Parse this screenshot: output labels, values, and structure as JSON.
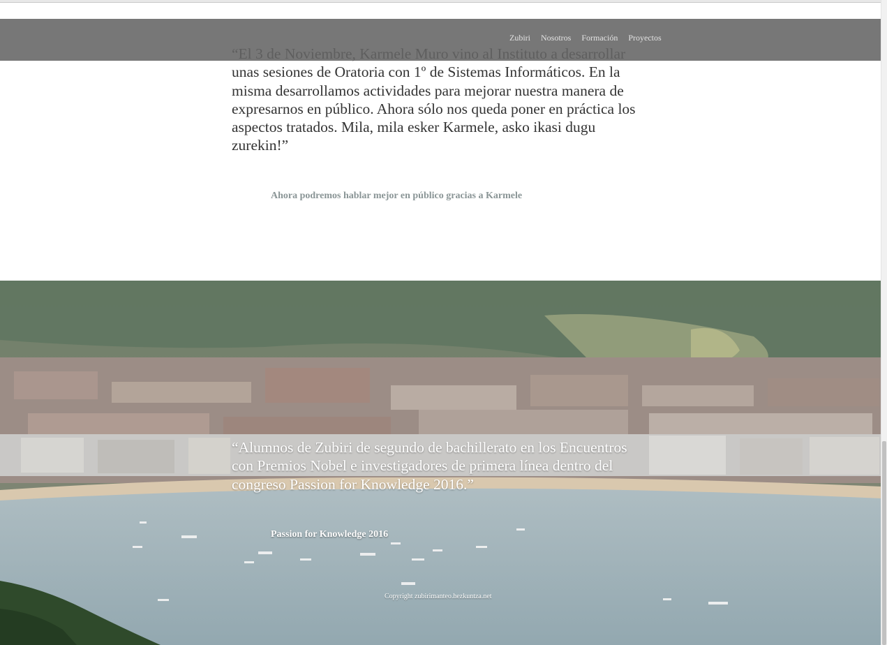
{
  "nav": {
    "items": [
      {
        "label": "Zubiri"
      },
      {
        "label": "Nosotros"
      },
      {
        "label": "Formación"
      },
      {
        "label": "Proyectos"
      }
    ]
  },
  "articles": [
    {
      "quote": "“El 3 de Noviembre, Karmele Muro vino al Instituto a desarrollar unas sesiones de Oratoria con 1º de Sistemas Informáticos. En la misma desarrollamos actividades para mejorar nuestra manera de expresarnos en público. Ahora sólo nos queda poner en práctica los aspectos tratados. Mila, mila esker Karmele, asko ikasi dugu zurekin!”",
      "caption": "Ahora podremos hablar mejor en público gracias a Karmele"
    },
    {
      "quote": "“Alumnos de Zubiri de segundo de bachillerato en los Encuentros con Premios Nobel e investigadores de primera línea dentro del congreso Passion for Knowledge 2016.”",
      "caption": "Passion for Knowledge 2016"
    }
  ],
  "footer": {
    "copyright": "Copyright zubirimanteo.hezkuntza.net"
  },
  "colors": {
    "navbar": "#646464",
    "caption_grey": "#8a9596",
    "quote_dark": "#333333"
  }
}
